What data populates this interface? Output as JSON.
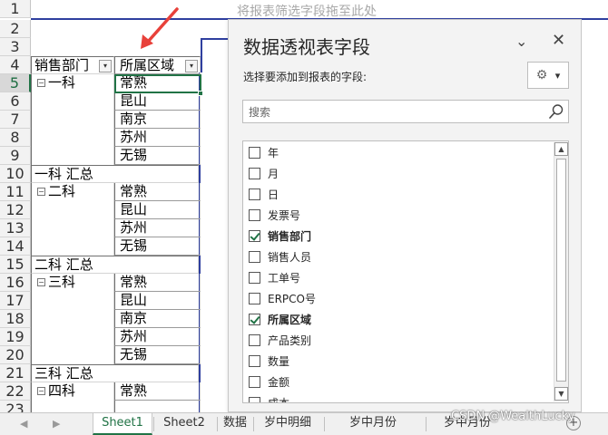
{
  "sheet": {
    "drop_hint": "将报表筛选字段拖至此处",
    "rows": [
      {
        "num": "1",
        "a": "",
        "b": "",
        "type": "empty"
      },
      {
        "num": "2",
        "a": "",
        "b": "",
        "type": "empty"
      },
      {
        "num": "3",
        "a": "",
        "b": "",
        "type": "empty"
      },
      {
        "num": "4",
        "a": "销售部门",
        "b": "所属区域",
        "type": "header"
      },
      {
        "num": "5",
        "a": "一科",
        "b": "常熟",
        "type": "group",
        "active": true
      },
      {
        "num": "6",
        "a": "",
        "b": "昆山",
        "type": "item"
      },
      {
        "num": "7",
        "a": "",
        "b": "南京",
        "type": "item"
      },
      {
        "num": "8",
        "a": "",
        "b": "苏州",
        "type": "item"
      },
      {
        "num": "9",
        "a": "",
        "b": "无锡",
        "type": "item"
      },
      {
        "num": "10",
        "a": "一科 汇总",
        "b": "",
        "type": "subtotal"
      },
      {
        "num": "11",
        "a": "二科",
        "b": "常熟",
        "type": "group"
      },
      {
        "num": "12",
        "a": "",
        "b": "昆山",
        "type": "item"
      },
      {
        "num": "13",
        "a": "",
        "b": "苏州",
        "type": "item"
      },
      {
        "num": "14",
        "a": "",
        "b": "无锡",
        "type": "item"
      },
      {
        "num": "15",
        "a": "二科 汇总",
        "b": "",
        "type": "subtotal"
      },
      {
        "num": "16",
        "a": "三科",
        "b": "常熟",
        "type": "group"
      },
      {
        "num": "17",
        "a": "",
        "b": "昆山",
        "type": "item"
      },
      {
        "num": "18",
        "a": "",
        "b": "南京",
        "type": "item"
      },
      {
        "num": "19",
        "a": "",
        "b": "苏州",
        "type": "item"
      },
      {
        "num": "20",
        "a": "",
        "b": "无锡",
        "type": "item"
      },
      {
        "num": "21",
        "a": "三科 汇总",
        "b": "",
        "type": "subtotal"
      },
      {
        "num": "22",
        "a": "四科",
        "b": "常熟",
        "type": "group"
      },
      {
        "num": "23",
        "a": "",
        "b": "",
        "type": "item"
      }
    ]
  },
  "panel": {
    "title": "数据透视表字段",
    "subtitle": "选择要添加到报表的字段:",
    "search_placeholder": "搜索",
    "fields": [
      {
        "label": "年",
        "checked": false
      },
      {
        "label": "月",
        "checked": false
      },
      {
        "label": "日",
        "checked": false
      },
      {
        "label": "发票号",
        "checked": false
      },
      {
        "label": "销售部门",
        "checked": true
      },
      {
        "label": "销售人员",
        "checked": false
      },
      {
        "label": "工单号",
        "checked": false
      },
      {
        "label": "ERPCO号",
        "checked": false
      },
      {
        "label": "所属区域",
        "checked": true
      },
      {
        "label": "产品类别",
        "checked": false
      },
      {
        "label": "数量",
        "checked": false
      },
      {
        "label": "金额",
        "checked": false
      },
      {
        "label": "成本",
        "checked": false
      }
    ]
  },
  "tabs": {
    "items": [
      "Sheet1",
      "Sheet2",
      "数据",
      "岁中明细",
      "岁中月份",
      "岁中月份"
    ],
    "active_index": 0
  },
  "watermark": "CSDN @WealthLucky",
  "colors": {
    "accent_green": "#217346",
    "pivot_blue": "#2f3f9f",
    "arrow_red": "#e8413a"
  },
  "icons": {
    "minus_glyph": "⊟",
    "chevron": "⌄",
    "close": "✕",
    "gear": "⚙",
    "caret": "▾",
    "add_sheet": "+"
  }
}
